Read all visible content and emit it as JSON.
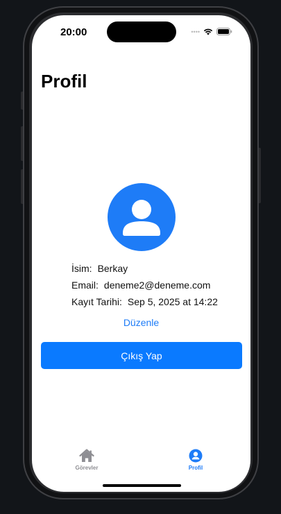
{
  "status_bar": {
    "time": "20:00",
    "signal_icon": "signal-dots-icon",
    "wifi_icon": "wifi-icon",
    "battery_icon": "battery-icon"
  },
  "page": {
    "title": "Profil"
  },
  "avatar": {
    "icon": "person-circle-icon",
    "color": "#1E7CF7"
  },
  "profile_info": {
    "name_label": "İsim:",
    "name_value": "Berkay",
    "email_label": "Email:",
    "email_value": "deneme2@deneme.com",
    "date_label": "Kayıt Tarihi:",
    "date_value": "Sep 5, 2025 at 14:22"
  },
  "actions": {
    "edit_label": "Düzenle",
    "logout_label": "Çıkış Yap"
  },
  "tab_bar": {
    "tabs": [
      {
        "label": "Görevler",
        "icon": "house-icon",
        "active": false
      },
      {
        "label": "Profil",
        "icon": "person-circle-icon",
        "active": true
      }
    ],
    "active_color": "#1E7CF7",
    "inactive_color": "#8E8E93"
  },
  "colors": {
    "accent": "#0A7AFF",
    "background": "#FFFFFF"
  }
}
